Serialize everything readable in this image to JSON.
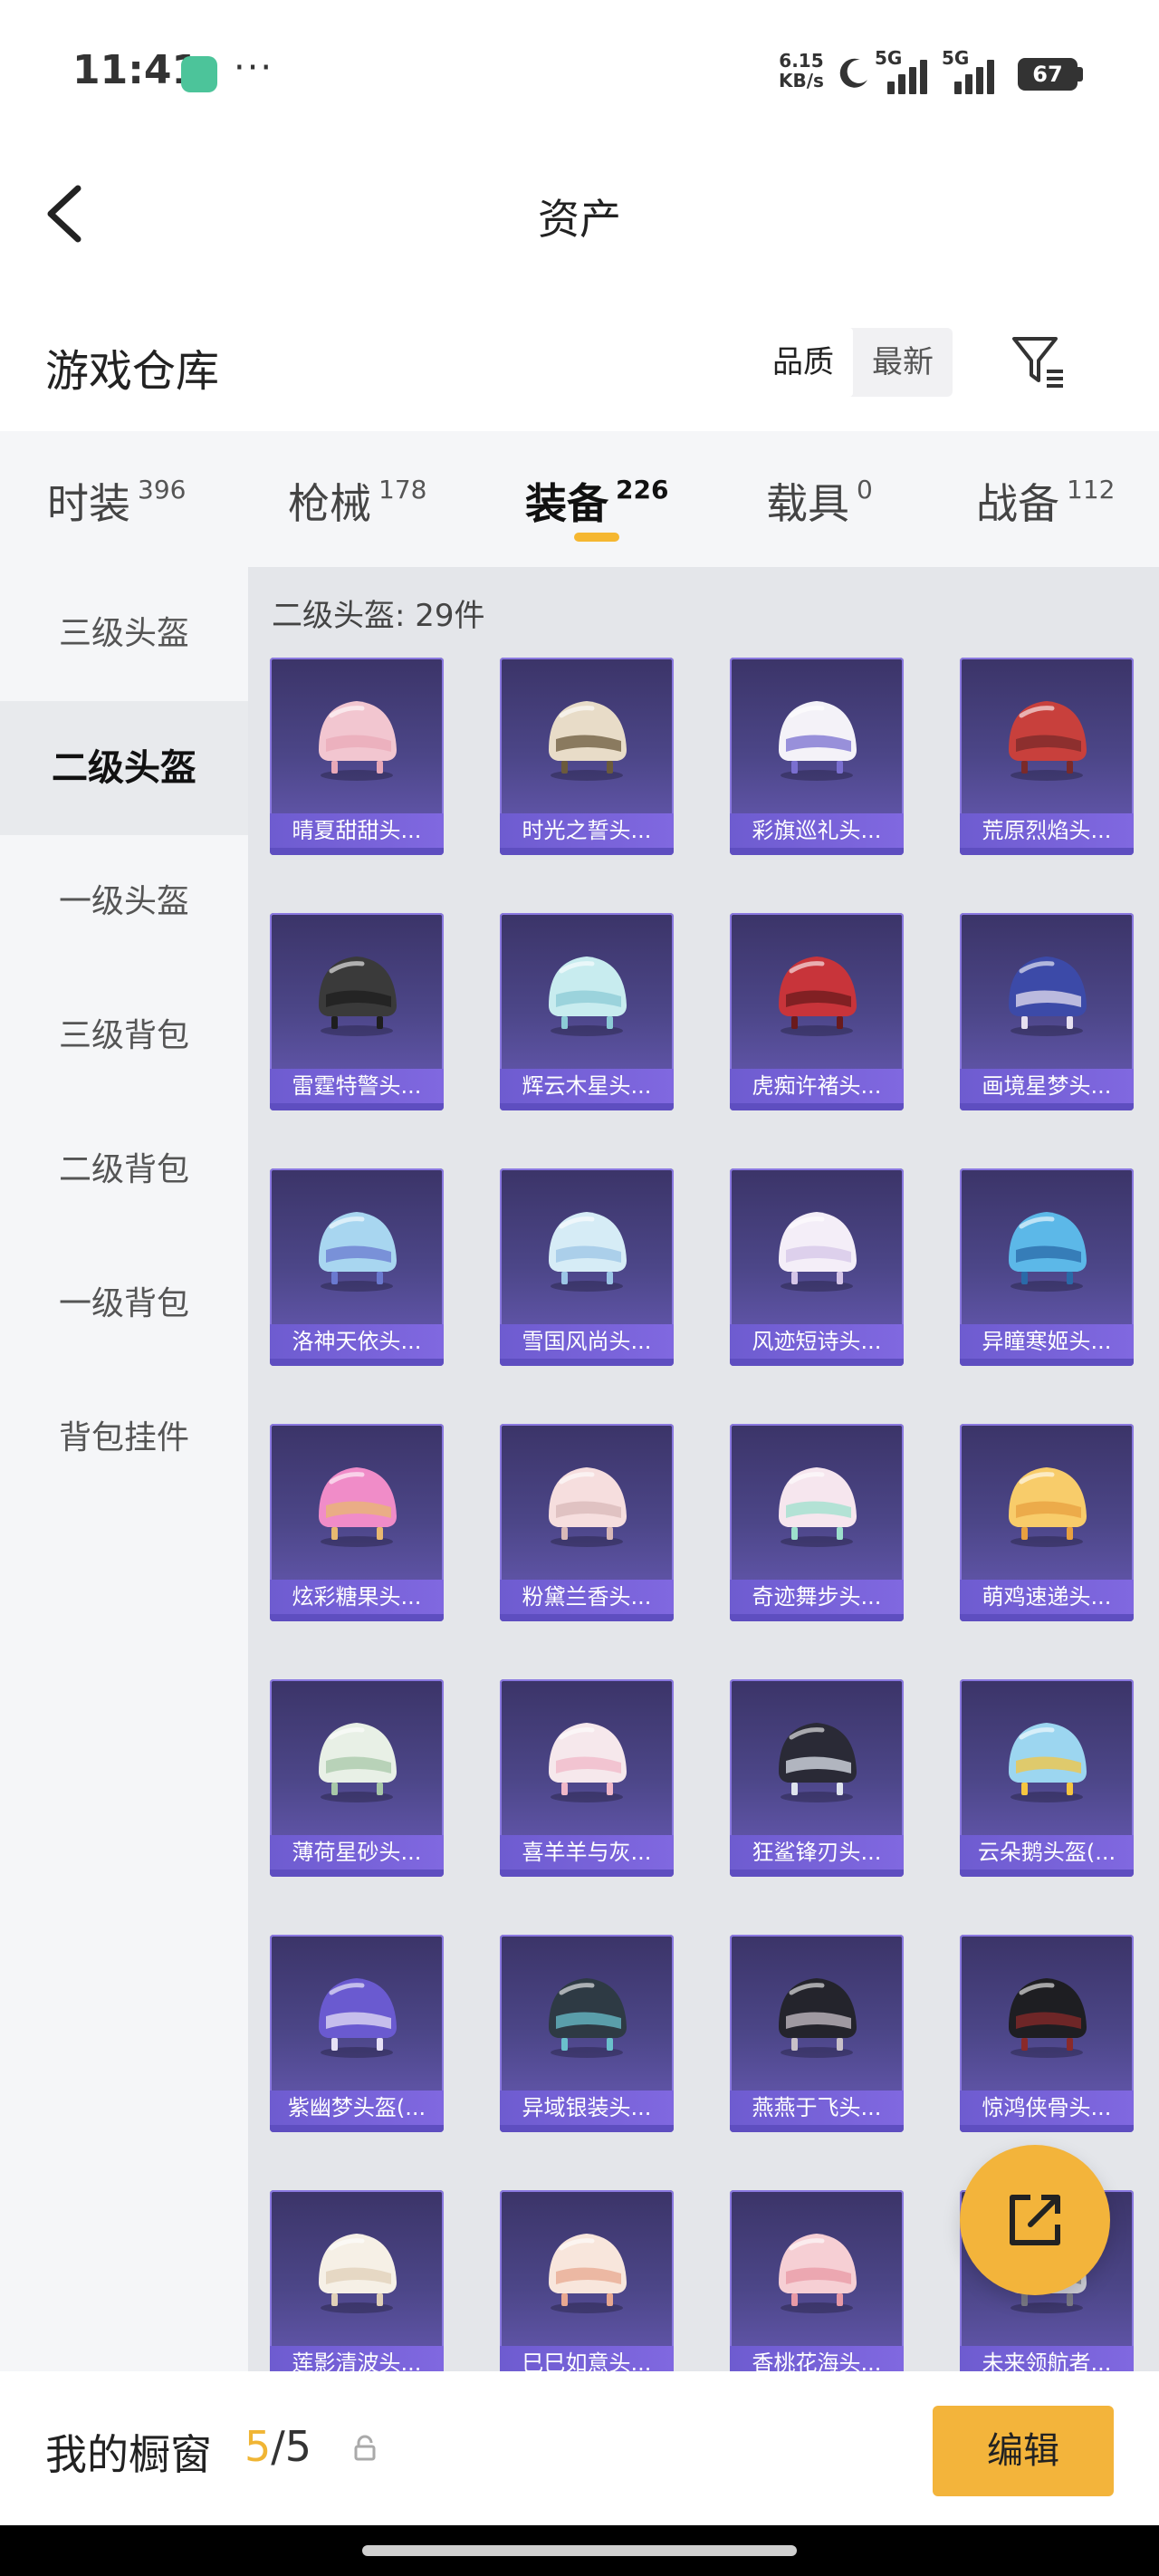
{
  "status_bar": {
    "time": "11:41",
    "dots": "···",
    "net_speed_value": "6.15",
    "net_speed_unit": "KB/s",
    "signal1_label": "5G",
    "signal2_label": "5G",
    "battery": "67"
  },
  "header": {
    "title": "资产"
  },
  "warehouse": {
    "title": "游戏仓库",
    "sort_options": [
      "品质",
      "最新"
    ],
    "sort_selected": "品质"
  },
  "tabs": [
    {
      "name": "时装",
      "count": "396"
    },
    {
      "name": "枪械",
      "count": "178"
    },
    {
      "name": "装备",
      "count": "226",
      "active": true
    },
    {
      "name": "载具",
      "count": "0"
    },
    {
      "name": "战备",
      "count": "112"
    }
  ],
  "sidebar": {
    "items": [
      "三级头盔",
      "二级头盔",
      "一级头盔",
      "三级背包",
      "二级背包",
      "一级背包",
      "背包挂件"
    ],
    "selected": "二级头盔"
  },
  "content": {
    "count_label": "二级头盔: 29件",
    "items": [
      {
        "label": "晴夏甜甜头...",
        "colors": [
          "#f2c6d0",
          "#e9a9b8"
        ]
      },
      {
        "label": "时光之誓头...",
        "colors": [
          "#e8dcc8",
          "#6b5a3c"
        ]
      },
      {
        "label": "彩旗巡礼头...",
        "colors": [
          "#f4f2f8",
          "#7a6fd0"
        ]
      },
      {
        "label": "荒原烈焰头...",
        "colors": [
          "#c8403c",
          "#7a2a2a"
        ]
      },
      {
        "label": "雷霆特警头...",
        "colors": [
          "#3a3a3a",
          "#1e1e1e"
        ]
      },
      {
        "label": "辉云木星头...",
        "colors": [
          "#c8ecef",
          "#8ccbd6"
        ]
      },
      {
        "label": "虎痴许褚头...",
        "colors": [
          "#c8343a",
          "#6a1a1c"
        ]
      },
      {
        "label": "画境星梦头...",
        "colors": [
          "#3c4aa8",
          "#e6e0f0"
        ]
      },
      {
        "label": "洛神天依头...",
        "colors": [
          "#a8d6f0",
          "#6a7ad0"
        ]
      },
      {
        "label": "雪国风尚头...",
        "colors": [
          "#d6ecf6",
          "#9cc6e6"
        ]
      },
      {
        "label": "风迹短诗头...",
        "colors": [
          "#f4eef8",
          "#d6c6e8"
        ]
      },
      {
        "label": "异瞳寒姬头...",
        "colors": [
          "#5cb8e8",
          "#2a6aa8"
        ]
      },
      {
        "label": "炫彩糖果头...",
        "colors": [
          "#f08cc8",
          "#e8b870"
        ]
      },
      {
        "label": "粉黛兰香头...",
        "colors": [
          "#f6dede",
          "#d8b8b8"
        ]
      },
      {
        "label": "奇迹舞步头...",
        "colors": [
          "#f6e6ee",
          "#9ce0cc"
        ]
      },
      {
        "label": "萌鸡速递头...",
        "colors": [
          "#f8cc6a",
          "#e8a040"
        ]
      },
      {
        "label": "薄荷星砂头...",
        "colors": [
          "#e8f0e6",
          "#a8c8a8"
        ]
      },
      {
        "label": "喜羊羊与灰...",
        "colors": [
          "#f6e8ec",
          "#f0b8c8"
        ]
      },
      {
        "label": "狂鲨锋刃头...",
        "colors": [
          "#2a2a36",
          "#dfe4ee"
        ]
      },
      {
        "label": "云朵鹅头盔(...",
        "colors": [
          "#9cd6f0",
          "#f6c640"
        ]
      },
      {
        "label": "紫幽梦头盔(...",
        "colors": [
          "#6a5ad0",
          "#e6e0f6"
        ]
      },
      {
        "label": "异域银装头...",
        "colors": [
          "#2e3a44",
          "#6ac0cc"
        ]
      },
      {
        "label": "燕燕于飞头...",
        "colors": [
          "#24242c",
          "#c8c0c8"
        ]
      },
      {
        "label": "惊鸿侠骨头...",
        "colors": [
          "#1e1e22",
          "#8a2a2a"
        ]
      },
      {
        "label": "莲影清波头...",
        "colors": [
          "#f6f0e6",
          "#e0d0b8"
        ]
      },
      {
        "label": "巳巳如意头...",
        "colors": [
          "#f8e6dc",
          "#e8a890"
        ]
      },
      {
        "label": "香桃花海头...",
        "colors": [
          "#f6cfd4",
          "#e89aa6"
        ]
      },
      {
        "label": "未来领航者...",
        "colors": [
          "#d0d0d8",
          "#7a7a86"
        ]
      }
    ]
  },
  "fab": {
    "icon": "share-external-icon"
  },
  "bottom_bar": {
    "label": "我的橱窗",
    "count_current": "5",
    "count_sep_total": "/5",
    "edit_label": "编辑"
  },
  "theme": {
    "accent": "#f3b43b",
    "card_label_bg": "#7562d8"
  }
}
